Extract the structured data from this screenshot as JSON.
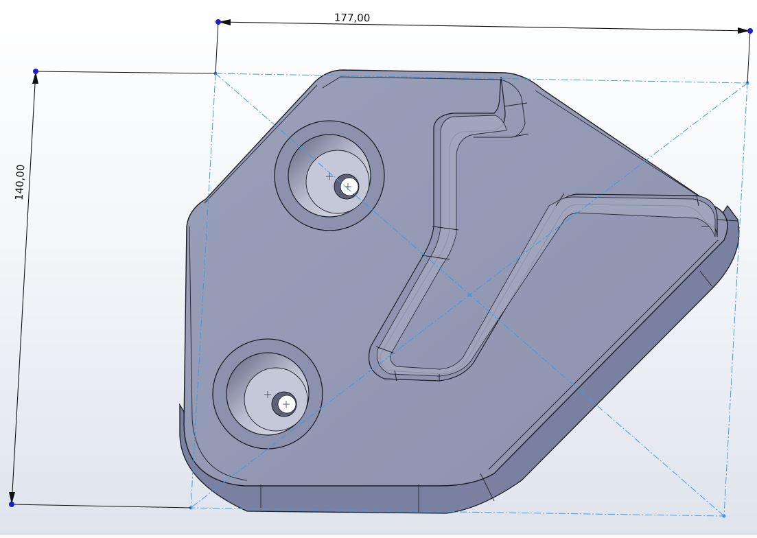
{
  "viewport": {
    "background_top": "#ffffff",
    "background_bottom": "#dfe4ec"
  },
  "part": {
    "face_color": "#969cb6",
    "side_color": "#7f86a3",
    "edge_color": "#1c1c24",
    "hole_count": 2,
    "slot_count": 1,
    "icons": [
      "hole-center-mark-icon"
    ]
  },
  "bounding_box": {
    "line_color": "#3b9be6",
    "line_style": "dash-dot"
  },
  "dimensions": {
    "width_value": "177,00",
    "height_value": "140,00",
    "dimension_color": "#111111",
    "handle_color": "#1d1dc9"
  }
}
